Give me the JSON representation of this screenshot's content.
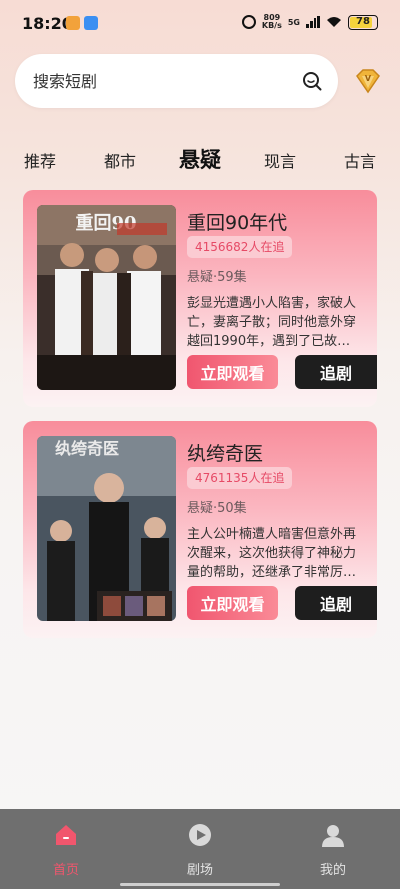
{
  "status_bar": {
    "time": "18:20",
    "speed_value": "809",
    "speed_unit": "KB/s",
    "network": "5G",
    "battery": "78"
  },
  "search": {
    "placeholder": "搜索短剧"
  },
  "tabs": [
    {
      "label": "推荐"
    },
    {
      "label": "都市"
    },
    {
      "label": "悬疑",
      "active": true
    },
    {
      "label": "现言"
    },
    {
      "label": "古言"
    }
  ],
  "cards": [
    {
      "title": "重回90年代",
      "watchers": "4156682人在追",
      "meta": "悬疑·59集",
      "synopsis": "彭显光遭遇小人陷害，家破人亡，妻离子散；同时他意外穿越回1990年，遇到了已故…",
      "watch_label": "立即观看",
      "follow_label": "追剧"
    },
    {
      "title": "纨绔奇医",
      "watchers": "4761135人在追",
      "meta": "悬疑·50集",
      "synopsis": "主人公叶楠遭人暗害但意外再次醒来，这次他获得了神秘力量的帮助，还继承了非常厉…",
      "watch_label": "立即观看",
      "follow_label": "追剧"
    }
  ],
  "bottom_nav": [
    {
      "label": "首页",
      "icon": "home-icon",
      "active": true
    },
    {
      "label": "剧场",
      "icon": "play-icon"
    },
    {
      "label": "我的",
      "icon": "profile-icon"
    }
  ],
  "colors": {
    "accent": "#f1566d",
    "nav_bg": "#6f6f6f",
    "follow_bg": "#1e1e1e"
  }
}
